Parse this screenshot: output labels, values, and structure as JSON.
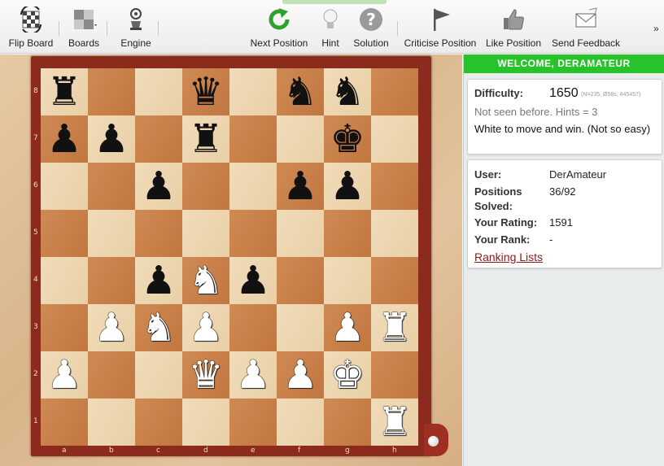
{
  "toolbar": {
    "flip_board": "Flip Board",
    "boards": "Boards",
    "engine": "Engine",
    "next_position": "Next Position",
    "hint": "Hint",
    "solution": "Solution",
    "criticise_position": "Criticise Position",
    "like_position": "Like Position",
    "send_feedback": "Send Feedback",
    "more": "»"
  },
  "board": {
    "files": [
      "a",
      "b",
      "c",
      "d",
      "e",
      "f",
      "g",
      "h"
    ],
    "ranks": [
      "8",
      "7",
      "6",
      "5",
      "4",
      "3",
      "2",
      "1"
    ],
    "pieces": [
      {
        "square": "a8",
        "piece": "b-rook",
        "glyph": "♜"
      },
      {
        "square": "d8",
        "piece": "b-queen",
        "glyph": "♛"
      },
      {
        "square": "f8",
        "piece": "b-knight",
        "glyph": "♞"
      },
      {
        "square": "g8",
        "piece": "b-knight",
        "glyph": "♞"
      },
      {
        "square": "a7",
        "piece": "b-pawn",
        "glyph": "♟"
      },
      {
        "square": "b7",
        "piece": "b-pawn",
        "glyph": "♟"
      },
      {
        "square": "d7",
        "piece": "b-rook",
        "glyph": "♜"
      },
      {
        "square": "g7",
        "piece": "b-king",
        "glyph": "♚"
      },
      {
        "square": "c6",
        "piece": "b-pawn",
        "glyph": "♟"
      },
      {
        "square": "f6",
        "piece": "b-pawn",
        "glyph": "♟"
      },
      {
        "square": "g6",
        "piece": "b-pawn",
        "glyph": "♟"
      },
      {
        "square": "c4",
        "piece": "b-pawn",
        "glyph": "♟"
      },
      {
        "square": "d4",
        "piece": "w-knight",
        "glyph": "♞"
      },
      {
        "square": "e4",
        "piece": "b-pawn",
        "glyph": "♟"
      },
      {
        "square": "b3",
        "piece": "w-pawn",
        "glyph": "♟"
      },
      {
        "square": "c3",
        "piece": "w-knight",
        "glyph": "♞"
      },
      {
        "square": "d3",
        "piece": "w-pawn",
        "glyph": "♟"
      },
      {
        "square": "g3",
        "piece": "w-pawn",
        "glyph": "♟"
      },
      {
        "square": "h3",
        "piece": "w-rook",
        "glyph": "♜"
      },
      {
        "square": "a2",
        "piece": "w-pawn",
        "glyph": "♟"
      },
      {
        "square": "d2",
        "piece": "w-queen",
        "glyph": "♛"
      },
      {
        "square": "e2",
        "piece": "w-pawn",
        "glyph": "♟"
      },
      {
        "square": "f2",
        "piece": "w-pawn",
        "glyph": "♟"
      },
      {
        "square": "g2",
        "piece": "w-king",
        "glyph": "♚"
      },
      {
        "square": "h1",
        "piece": "w-rook",
        "glyph": "♜"
      }
    ]
  },
  "panel": {
    "welcome": "WELCOME, DERAMATEUR",
    "difficulty_label": "Difficulty:",
    "difficulty_value": "1650",
    "difficulty_meta": "(N=235, Ø58s, #45457)",
    "hints_note": "Not seen before. Hints = 3",
    "task": "White to move and win. (Not so easy)",
    "user_label": "User:",
    "user_value": "DerAmateur",
    "solved_label": "Positions Solved:",
    "solved_value": "36/92",
    "rating_label": "Your Rating:",
    "rating_value": "1591",
    "rank_label": "Your Rank:",
    "rank_value": "-",
    "ranking_link": "Ranking Lists"
  },
  "colors": {
    "welcome_bar": "#28c22b",
    "board_light": "#f1dcb9",
    "board_dark": "#c97f48",
    "frame": "#8c2a1e",
    "link": "#8a1a1a"
  }
}
